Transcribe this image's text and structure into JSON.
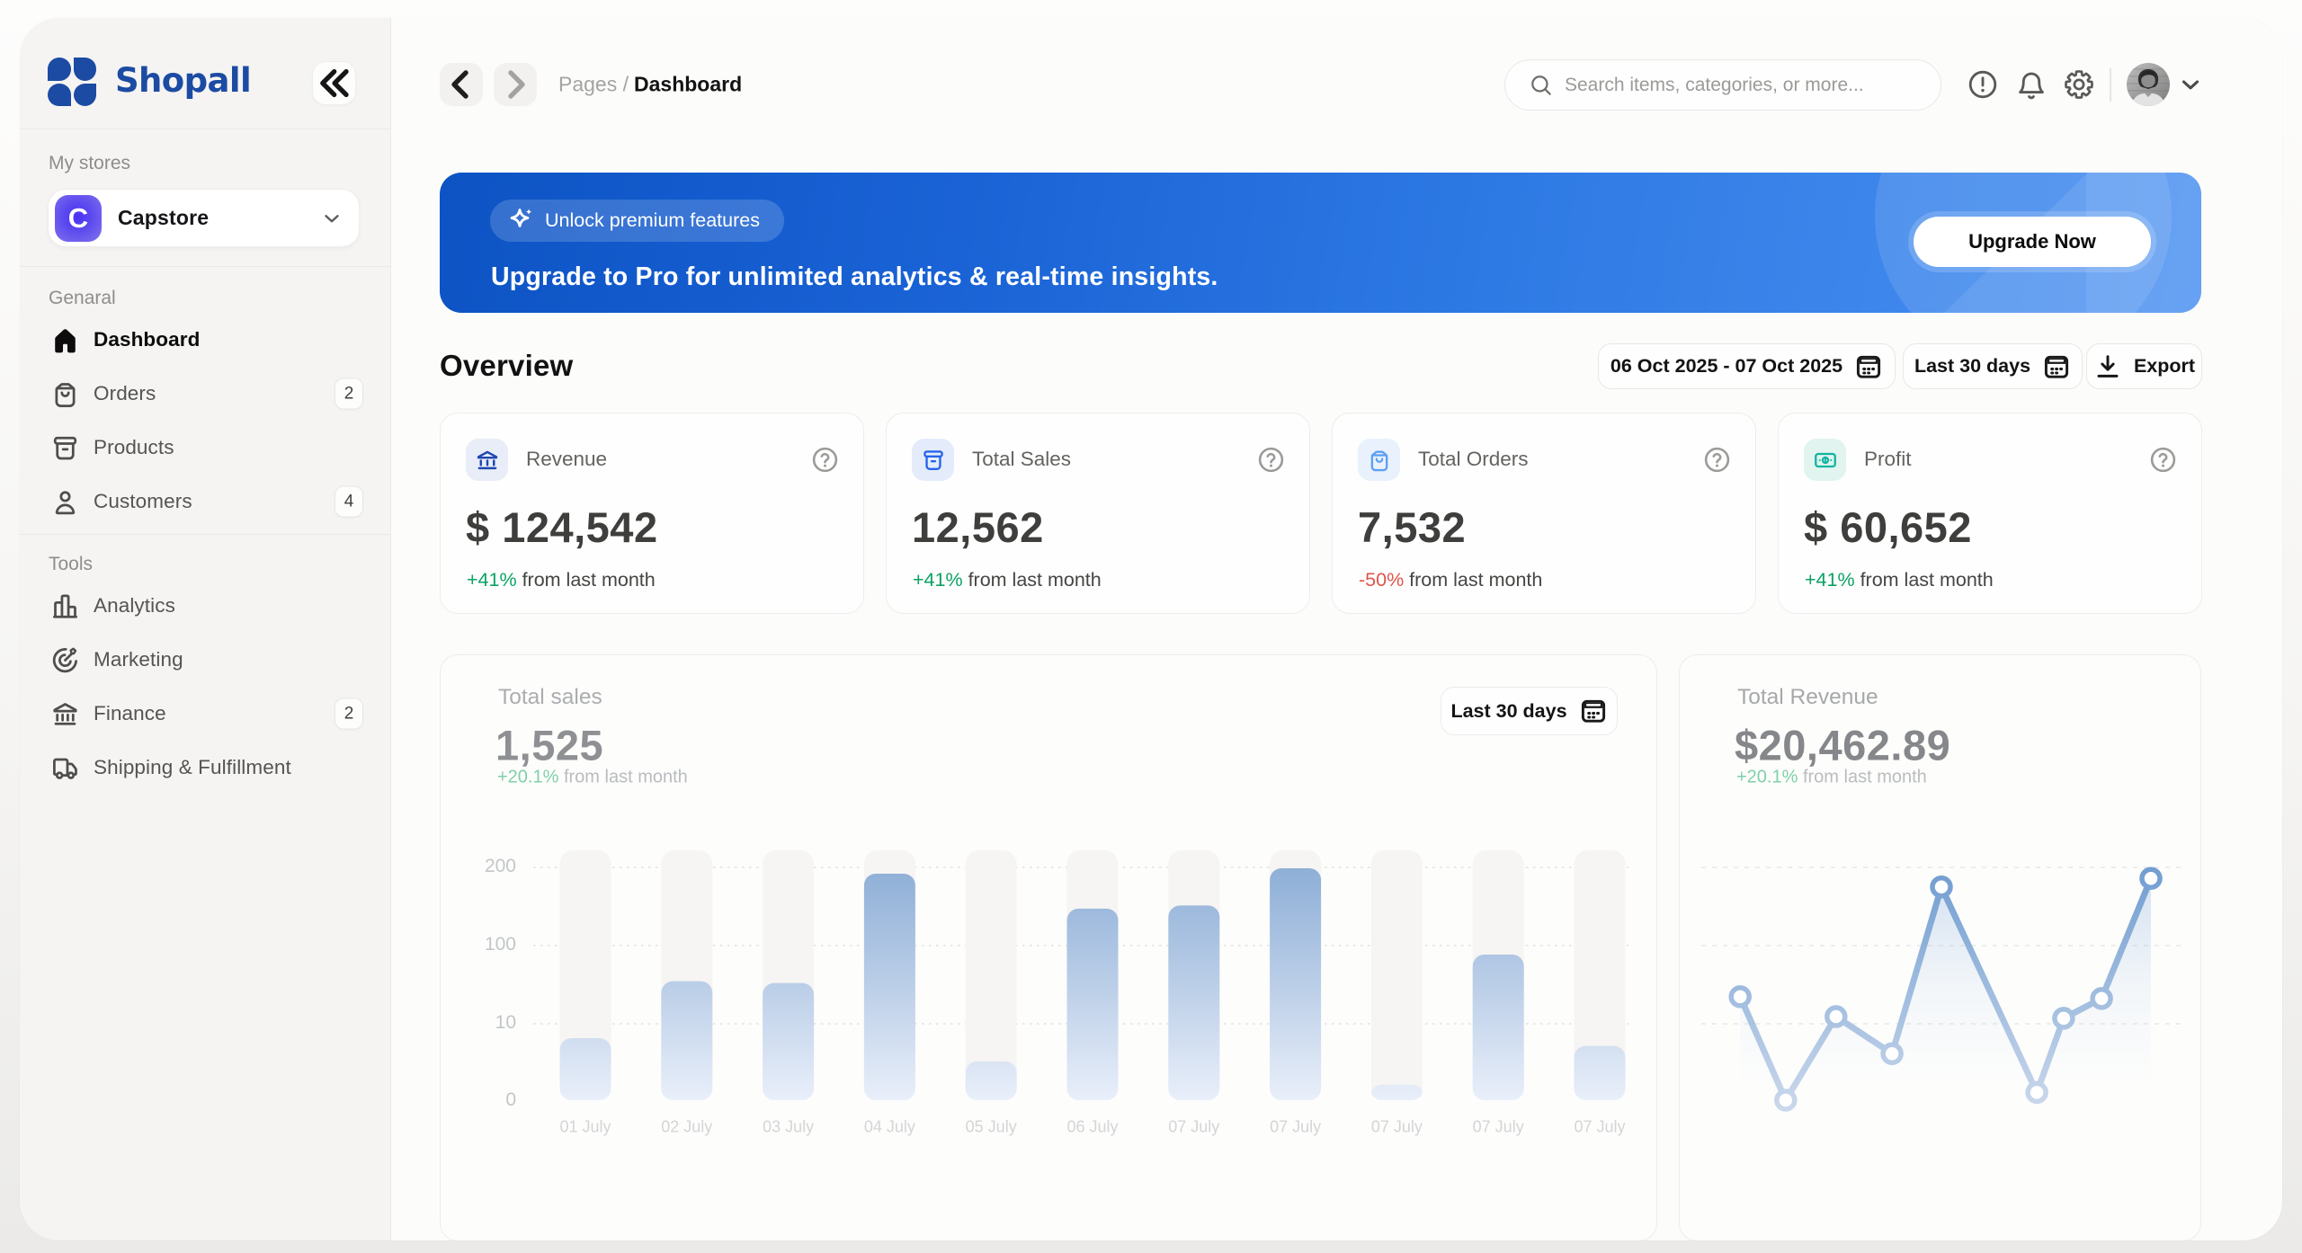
{
  "app": {
    "name": "Shopall"
  },
  "sidebar": {
    "stores_label": "My stores",
    "store": {
      "initial": "C",
      "name": "Capstore"
    },
    "sections": [
      {
        "label": "Genaral",
        "items": [
          {
            "id": "dashboard",
            "label": "Dashboard",
            "icon": "home-icon",
            "active": true
          },
          {
            "id": "orders",
            "label": "Orders",
            "icon": "orders-bag-icon",
            "badge": "2"
          },
          {
            "id": "products",
            "label": "Products",
            "icon": "products-box-icon"
          },
          {
            "id": "customers",
            "label": "Customers",
            "icon": "customers-icon",
            "badge": "4"
          }
        ]
      },
      {
        "label": "Tools",
        "items": [
          {
            "id": "analytics",
            "label": "Analytics",
            "icon": "analytics-icon"
          },
          {
            "id": "marketing",
            "label": "Marketing",
            "icon": "marketing-icon"
          },
          {
            "id": "finance",
            "label": "Finance",
            "icon": "finance-icon",
            "badge": "2"
          },
          {
            "id": "shipping",
            "label": "Shipping & Fulfillment",
            "icon": "shipping-icon"
          }
        ]
      }
    ]
  },
  "header": {
    "breadcrumb_section": "Pages",
    "breadcrumb_separator": "/",
    "breadcrumb_current": "Dashboard",
    "search_placeholder": "Search items, categories, or more...",
    "icons": [
      "chevron-left-icon",
      "chevron-right-icon",
      "search-icon",
      "alert-circle-icon",
      "bell-icon",
      "gear-icon",
      "avatar",
      "chevron-down-icon"
    ]
  },
  "banner": {
    "pill_label": "Unlock premium features",
    "headline": "Upgrade to Pro for unlimited analytics & real-time insights.",
    "cta_label": "Upgrade Now"
  },
  "overview": {
    "title": "Overview",
    "date_range": "06 Oct 2025 - 07 Oct 2025",
    "period": "Last 30 days",
    "export_label": "Export"
  },
  "stats": [
    {
      "label": "Revenue",
      "value": "$ 124,542",
      "delta": "+41%",
      "direction": "up",
      "delta_suffix": "from last month",
      "icon": "bank-icon",
      "chip_bg": "#e8edf8",
      "icon_color": "#1e47b0"
    },
    {
      "label": "Total Sales",
      "value": "12,562",
      "delta": "+41%",
      "direction": "up",
      "delta_suffix": "from last month",
      "icon": "products-box-icon",
      "chip_bg": "#e4ecfb",
      "icon_color": "#2563eb"
    },
    {
      "label": "Total Orders",
      "value": "7,532",
      "delta": "-50%",
      "direction": "down",
      "delta_suffix": "from last month",
      "icon": "orders-bag-icon",
      "chip_bg": "#e9f1fd",
      "icon_color": "#5da0f5"
    },
    {
      "label": "Profit",
      "value": "$ 60,652",
      "delta": "+41%",
      "direction": "up",
      "delta_suffix": "from last month",
      "icon": "banknote-icon",
      "chip_bg": "#e1f4ef",
      "icon_color": "#12b5a0"
    }
  ],
  "chart_data": [
    {
      "type": "bar",
      "title": "Total sales",
      "total": "1,525",
      "delta": "+20.1%",
      "delta_suffix": "from last month",
      "period": "Last 30 days",
      "categories": [
        "01 July",
        "02 July",
        "03 July",
        "04 July",
        "05 July",
        "06 July",
        "07 July",
        "07 July",
        "07 July",
        "07 July",
        "07 July"
      ],
      "values": [
        8,
        58,
        56,
        192,
        5,
        147,
        151,
        199,
        2,
        89,
        7
      ],
      "yticks": [
        200,
        100,
        10,
        0
      ],
      "grid": "dotted",
      "ylabel": "",
      "xlabel": ""
    },
    {
      "type": "line",
      "title": "Total Revenue",
      "total": "$20,462.89",
      "delta": "+20.1%",
      "delta_suffix": "from last month",
      "x_frac": [
        0.081,
        0.176,
        0.281,
        0.398,
        0.501,
        0.7,
        0.756,
        0.835,
        0.938
      ],
      "values": [
        40,
        0,
        17,
        6,
        175,
        1,
        15,
        38,
        186
      ],
      "yticks": [
        200,
        100,
        10,
        0
      ],
      "grid": "dashed"
    }
  ],
  "colors": {
    "brand_blue": "#1c4ba3",
    "banner_gradient_start": "#0d53c4",
    "banner_gradient_end": "#4a90f1",
    "green_up": "#0ba263",
    "red_down": "#e0544b",
    "bar_top": "#7da4d2",
    "bar_bottom": "#eef3fa"
  }
}
